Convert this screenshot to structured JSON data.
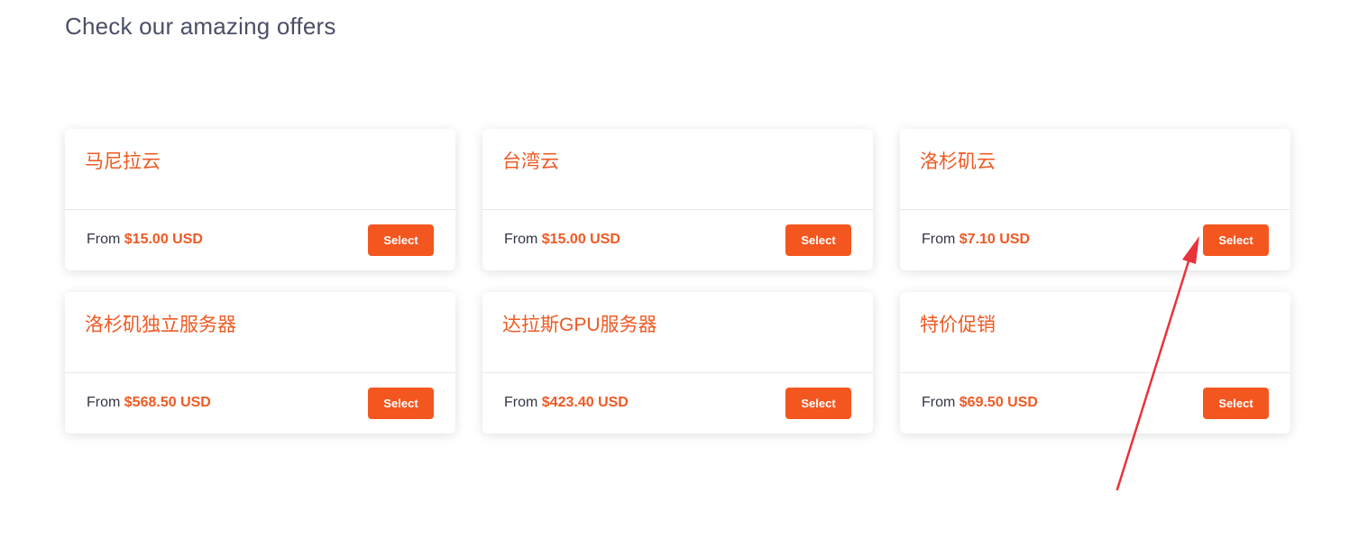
{
  "page": {
    "title": "Check our amazing offers"
  },
  "offers": [
    {
      "name": "马尼拉云",
      "price_prefix": "From",
      "price": "$15.00 USD",
      "button_label": "Select"
    },
    {
      "name": "台湾云",
      "price_prefix": "From",
      "price": "$15.00 USD",
      "button_label": "Select"
    },
    {
      "name": "洛杉矶云",
      "price_prefix": "From",
      "price": "$7.10 USD",
      "button_label": "Select"
    },
    {
      "name": "洛杉矶独立服务器",
      "price_prefix": "From",
      "price": "$568.50 USD",
      "button_label": "Select"
    },
    {
      "name": "达拉斯GPU服务器",
      "price_prefix": "From",
      "price": "$423.40 USD",
      "button_label": "Select"
    },
    {
      "name": "特价促销",
      "price_prefix": "From",
      "price": "$69.50 USD",
      "button_label": "Select"
    }
  ],
  "colors": {
    "accent": "#f4561f",
    "title_text": "#4b4f66",
    "annotation_arrow": "#e8333a"
  },
  "annotation": {
    "icon": "red-arrow-icon"
  }
}
